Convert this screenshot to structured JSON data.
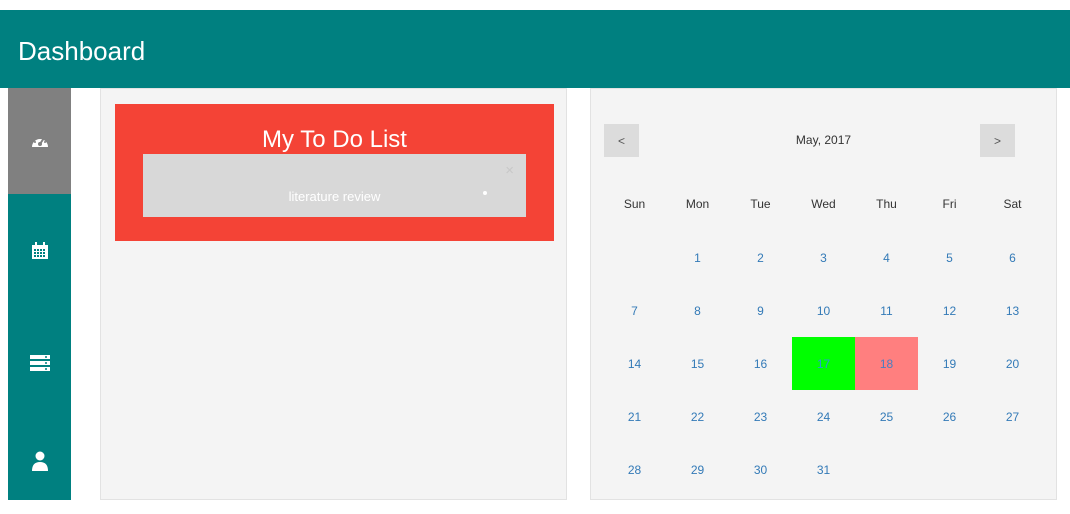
{
  "header": {
    "title": "Dashboard"
  },
  "sidebar": {
    "items": [
      {
        "icon": "dashboard-gauge-icon",
        "active": true
      },
      {
        "icon": "calendar-icon",
        "active": false
      },
      {
        "icon": "server-list-icon",
        "active": false
      },
      {
        "icon": "user-icon",
        "active": false
      }
    ]
  },
  "todo": {
    "title": "My To Do List",
    "items": [
      {
        "text": "literature review"
      }
    ],
    "close_glyph": "×"
  },
  "calendar": {
    "month_label": "May, 2017",
    "prev_label": "<",
    "next_label": ">",
    "weekdays": [
      "Sun",
      "Mon",
      "Tue",
      "Wed",
      "Thu",
      "Fri",
      "Sat"
    ],
    "first_weekday": 1,
    "days_in_month": 31,
    "today": 17,
    "selected": 18,
    "colors": {
      "today": "#00ff00",
      "selected": "#ff7f7f",
      "day_text": "#337ab7"
    }
  },
  "colors": {
    "header": "#008080",
    "sidebar": "#008080",
    "sidebar_active": "#808080",
    "todo_box": "#f44336"
  }
}
